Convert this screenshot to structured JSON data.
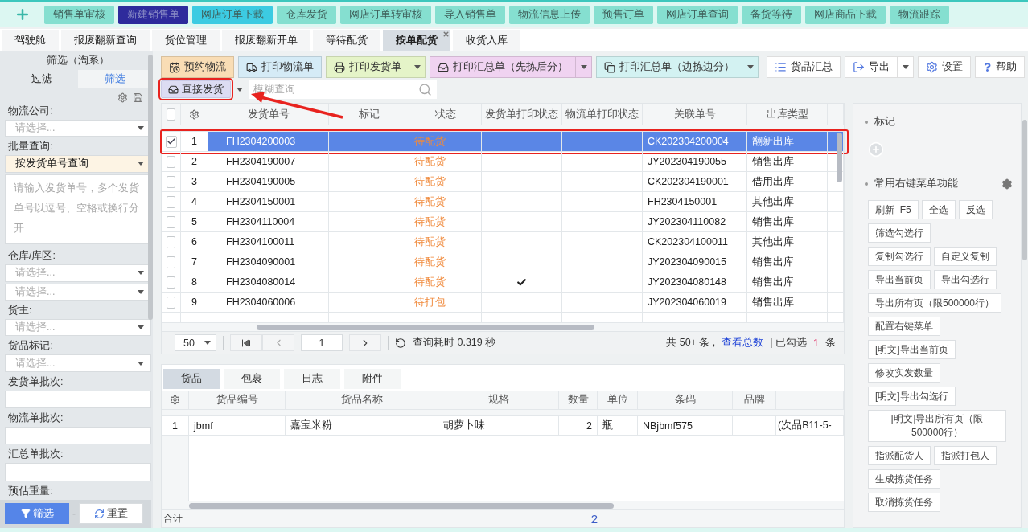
{
  "top_menu": {
    "items": [
      {
        "label": "销售单审核",
        "color": "#85dfd0"
      },
      {
        "label": "新建销售单",
        "color": "#2e2b9c"
      },
      {
        "label": "网店订单下载",
        "color": "#3ccbe2"
      },
      {
        "label": "仓库发货",
        "color": "#85dfd0"
      },
      {
        "label": "网店订单转审核",
        "color": "#85dfd0"
      },
      {
        "label": "导入销售单",
        "color": "#85dfd0"
      },
      {
        "label": "物流信息上传",
        "color": "#85dfd0"
      },
      {
        "label": "预售订单",
        "color": "#85dfd0"
      },
      {
        "label": "网店订单查询",
        "color": "#85dfd0"
      },
      {
        "label": "备货等待",
        "color": "#85dfd0"
      },
      {
        "label": "网店商品下载",
        "color": "#85dfd0"
      },
      {
        "label": "物流跟踪",
        "color": "#85dfd0"
      }
    ]
  },
  "page_tabs": [
    {
      "label": "驾驶舱",
      "selected": false,
      "closable": false
    },
    {
      "label": "报废翻新查询",
      "selected": false,
      "closable": false
    },
    {
      "label": "货位管理",
      "selected": false,
      "closable": false
    },
    {
      "label": "报废翻新开单",
      "selected": false,
      "closable": false
    },
    {
      "label": "等待配货",
      "selected": false,
      "closable": false
    },
    {
      "label": "按单配货",
      "selected": true,
      "closable": true
    },
    {
      "label": "收货入库",
      "selected": false,
      "closable": false
    }
  ],
  "filter_panel": {
    "title": "筛选（淘系）",
    "tabs": [
      {
        "label": "过滤",
        "selected": false
      },
      {
        "label": "筛选",
        "selected": true
      }
    ],
    "fields": [
      {
        "kind": "select",
        "label": "物流公司:",
        "placeholder": "请选择..."
      },
      {
        "kind": "select",
        "label": "批量查询:",
        "value": "按发货单号查询"
      },
      {
        "kind": "textarea",
        "placeholder": "请输入发货单号，多个发货单号以逗号、空格或换行分开"
      },
      {
        "kind": "select",
        "label": "仓库/库区:",
        "placeholder": "请选择..."
      },
      {
        "kind": "select",
        "placeholder": "请选择..."
      },
      {
        "kind": "select",
        "label": "货主:",
        "placeholder": "请选择..."
      },
      {
        "kind": "select",
        "label": "货品标记:",
        "placeholder": "请选择..."
      },
      {
        "kind": "input",
        "label": "发货单批次:"
      },
      {
        "kind": "input",
        "label": "物流单批次:"
      },
      {
        "kind": "input",
        "label": "汇总单批次:"
      },
      {
        "kind": "label",
        "label": "预估重量:"
      }
    ],
    "filter_button": "筛选",
    "separator": "-",
    "reset_button": "重置"
  },
  "toolbar": {
    "buttons": [
      {
        "label": "预约物流",
        "color": "#f9ddb5",
        "dropdown": false
      },
      {
        "label": "打印物流单",
        "color": "#d5ebf6",
        "dropdown": false
      },
      {
        "label": "打印发货单",
        "color": "#e5f4c8",
        "dropdown": true
      },
      {
        "label": "打印汇总单（先拣后分）",
        "color": "#f0d3f1",
        "dropdown": true
      },
      {
        "label": "打印汇总单（边拣边分）",
        "color": "#d3f2f2",
        "dropdown": true
      }
    ],
    "right_buttons": [
      {
        "label": "货品汇总",
        "dropdown": false
      },
      {
        "label": "导出",
        "dropdown": true
      },
      {
        "label": "设置",
        "dropdown": false
      },
      {
        "label": "帮助",
        "dropdown": false
      }
    ],
    "direct_ship": {
      "label": "直接发货",
      "highlighted": true
    },
    "search": {
      "placeholder": "模糊查询"
    }
  },
  "orders_table": {
    "all_checked": false,
    "columns": [
      "发货单号",
      "标记",
      "状态",
      "发货单打印状态",
      "物流单打印状态",
      "关联单号",
      "出库类型"
    ],
    "rows": [
      {
        "index": "1",
        "selected": true,
        "highlighted": true,
        "order_no": "FH2304200003",
        "status": "待配货",
        "invoice_printed": false,
        "related_no": "CK202304200004",
        "out_type": "翻新出库"
      },
      {
        "index": "2",
        "selected": false,
        "highlighted": false,
        "order_no": "FH2304190007",
        "status": "待配货",
        "invoice_printed": false,
        "related_no": "JY202304190055",
        "out_type": "销售出库"
      },
      {
        "index": "3",
        "selected": false,
        "highlighted": false,
        "order_no": "FH2304190005",
        "status": "待配货",
        "invoice_printed": false,
        "related_no": "CK202304190001",
        "out_type": "借用出库"
      },
      {
        "index": "4",
        "selected": false,
        "highlighted": false,
        "order_no": "FH2304150001",
        "status": "待配货",
        "invoice_printed": false,
        "related_no": "FH2304150001",
        "out_type": "其他出库"
      },
      {
        "index": "5",
        "selected": false,
        "highlighted": false,
        "order_no": "FH2304110004",
        "status": "待配货",
        "invoice_printed": false,
        "related_no": "JY202304110082",
        "out_type": "销售出库"
      },
      {
        "index": "6",
        "selected": false,
        "highlighted": false,
        "order_no": "FH2304100011",
        "status": "待配货",
        "invoice_printed": false,
        "related_no": "CK202304100011",
        "out_type": "其他出库"
      },
      {
        "index": "7",
        "selected": false,
        "highlighted": false,
        "order_no": "FH2304090001",
        "status": "待配货",
        "invoice_printed": false,
        "related_no": "JY202304090015",
        "out_type": "销售出库"
      },
      {
        "index": "8",
        "selected": false,
        "highlighted": false,
        "order_no": "FH2304080014",
        "status": "待配货",
        "invoice_printed": true,
        "related_no": "JY202304080148",
        "out_type": "销售出库"
      },
      {
        "index": "9",
        "selected": false,
        "highlighted": false,
        "order_no": "FH2304060006",
        "status": "待打包",
        "invoice_printed": false,
        "related_no": "JY202304060019",
        "out_type": "销售出库"
      }
    ]
  },
  "pager": {
    "page_size": "50",
    "page": "1",
    "query_time": "查询耗时 0.319 秒",
    "total": "共 50+ 条 ,",
    "view_total_link": "查看总数",
    "checked_label": "| 已勾选",
    "checked_count": "1",
    "checked_unit": "条"
  },
  "detail_tabs": [
    {
      "label": "货品",
      "selected": true
    },
    {
      "label": "包裹",
      "selected": false
    },
    {
      "label": "日志",
      "selected": false
    },
    {
      "label": "附件",
      "selected": false
    }
  ],
  "detail_table": {
    "columns": [
      "货品编号",
      "货品名称",
      "规格",
      "数量",
      "单位",
      "条码",
      "品牌"
    ],
    "rows": [
      {
        "index": "1",
        "cells": [
          "jbmf",
          "嘉宝米粉",
          "胡萝卜味",
          "2",
          "瓶",
          "NBjbmf575",
          "",
          "(次品B11-5-"
        ]
      }
    ],
    "footer": {
      "label": "合计",
      "quantity_total": "2"
    }
  },
  "right_panel": {
    "mark_title": "标记",
    "menu_title": "常用右键菜单功能",
    "menu_rows": [
      [
        "刷新  F5",
        "全选",
        "反选"
      ],
      [
        "筛选勾选行"
      ],
      [
        "复制勾选行",
        "自定义复制"
      ],
      [
        "导出当前页",
        "导出勾选行"
      ],
      [
        "导出所有页（限500000行）"
      ],
      [
        "配置右键菜单"
      ],
      [
        "[明文]导出当前页"
      ],
      [
        "修改实发数量"
      ],
      [
        "[明文]导出勾选行"
      ],
      [
        "[明文]导出所有页（限500000行）"
      ],
      [
        "指派配货人",
        "指派打包人"
      ],
      [
        "生成拣货任务"
      ],
      [
        "取消拣货任务"
      ]
    ]
  }
}
